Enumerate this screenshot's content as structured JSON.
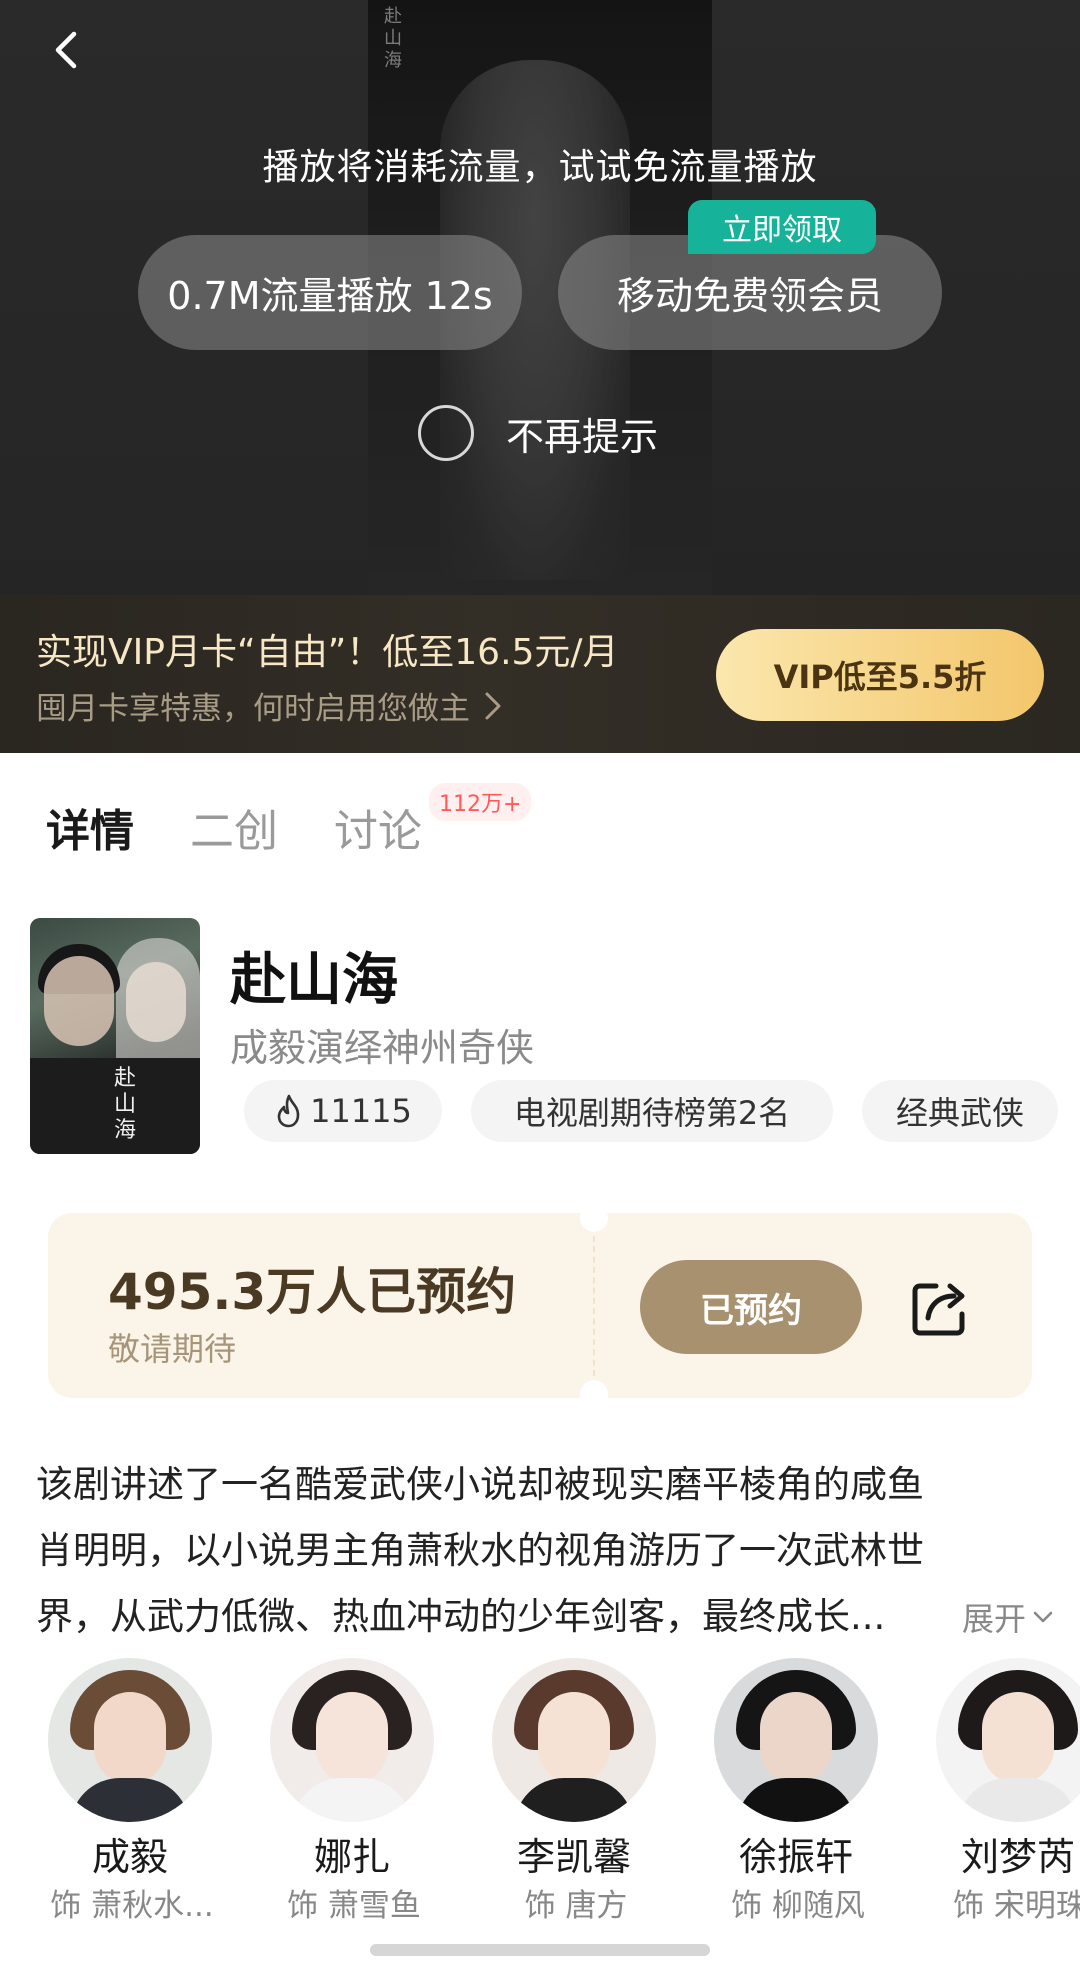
{
  "player": {
    "poster_calligraphy": "赴山海",
    "flow_hint": "播放将消耗流量，试试免流量播放",
    "data_play_button": "0.7M流量播放 12s",
    "free_member_button": "移动免费领会员",
    "claim_badge": "立即领取",
    "no_remind_label": "不再提示"
  },
  "vip_banner": {
    "title": "实现VIP月卡“自由”！低至16.5元/月",
    "subtitle": "囤月卡享特惠，何时启用您做主",
    "button": "VIP低至5.5折"
  },
  "tabs": [
    {
      "label": "详情",
      "active": true
    },
    {
      "label": "二创",
      "active": false
    },
    {
      "label": "讨论",
      "active": false
    }
  ],
  "discussion_count": "112万+",
  "show": {
    "poster_calligraphy": "赴山海",
    "title": "赴山海",
    "subtitle": "成毅演绎神州奇侠",
    "heat": "11115",
    "rank": "电视剧期待榜第2名",
    "genre": "经典武侠"
  },
  "reservation": {
    "count_text": "495.3万人已预约",
    "sub_text": "敬请期待",
    "button": "已预约"
  },
  "synopsis": {
    "lines": [
      "该剧讲述了一名酷爱武侠小说却被现实磨平棱角的咸鱼",
      "肖明明，以小说男主角萧秋水的视角游历了一次武林世",
      "界，从武力低微、热血冲动的少年剑客，最终成长..."
    ],
    "expand_label": "展开"
  },
  "cast": [
    {
      "name": "成毅",
      "role": "饰 萧秋水..."
    },
    {
      "name": "娜扎",
      "role": "饰 萧雪鱼"
    },
    {
      "name": "李凯馨",
      "role": "饰 唐方"
    },
    {
      "name": "徐振轩",
      "role": "饰 柳随风"
    },
    {
      "name": "刘梦芮",
      "role": "饰 宋明珠"
    }
  ],
  "colors": {
    "accent_teal": "#16b39a",
    "vip_gold": "#f3c66b",
    "reserve_card": "#fbf4e8",
    "reserved_button": "#a8916f",
    "badge_red": "#ff5a5a"
  }
}
